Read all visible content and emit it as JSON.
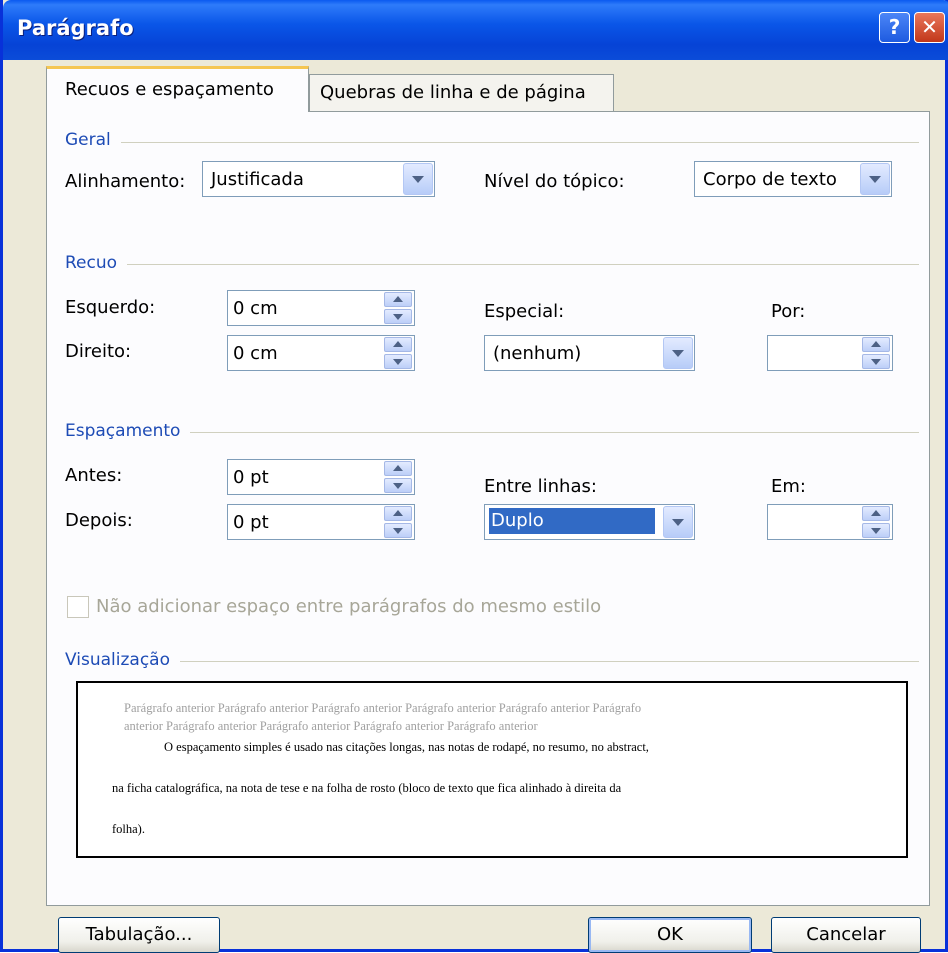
{
  "window": {
    "title": "Parágrafo",
    "help_glyph": "?",
    "close_glyph": "✕"
  },
  "tabs": [
    {
      "label": "Recuos e espaçamento",
      "selected": true
    },
    {
      "label": "Quebras de linha e de página",
      "selected": false
    }
  ],
  "geral": {
    "heading": "Geral",
    "alinhamento_label": "Alinhamento:",
    "alinhamento_value": "Justificada",
    "nivel_label": "Nível do tópico:",
    "nivel_value": "Corpo de texto"
  },
  "recuo": {
    "heading": "Recuo",
    "esquerdo_label": "Esquerdo:",
    "esquerdo_value": "0 cm",
    "direito_label": "Direito:",
    "direito_value": "0 cm",
    "especial_label": "Especial:",
    "especial_value": "(nenhum)",
    "por_label": "Por:",
    "por_value": ""
  },
  "espacamento": {
    "heading": "Espaçamento",
    "antes_label": "Antes:",
    "antes_value": "0 pt",
    "depois_label": "Depois:",
    "depois_value": "0 pt",
    "entre_linhas_label": "Entre linhas:",
    "entre_linhas_value": "Duplo",
    "em_label": "Em:",
    "em_value": "",
    "checkbox_label": "Não adicionar espaço entre parágrafos do mesmo estilo",
    "checkbox_checked": false,
    "checkbox_enabled": false
  },
  "visualizacao": {
    "heading": "Visualização",
    "prev_line1": "Parágrafo anterior Parágrafo anterior Parágrafo anterior Parágrafo anterior Parágrafo anterior Parágrafo",
    "prev_line2": "anterior Parágrafo anterior Parágrafo anterior Parágrafo anterior Parágrafo anterior",
    "sample_line1": "O espaçamento simples é usado nas citações longas, nas notas de rodapé, no resumo, no abstract,",
    "sample_line2": "na ficha catalográfica, na nota de tese e na folha de rosto (bloco de texto que fica alinhado à direita da",
    "sample_line3": "folha)."
  },
  "buttons": {
    "tabulacao": "Tabulação...",
    "ok": "OK",
    "cancelar": "Cancelar"
  }
}
